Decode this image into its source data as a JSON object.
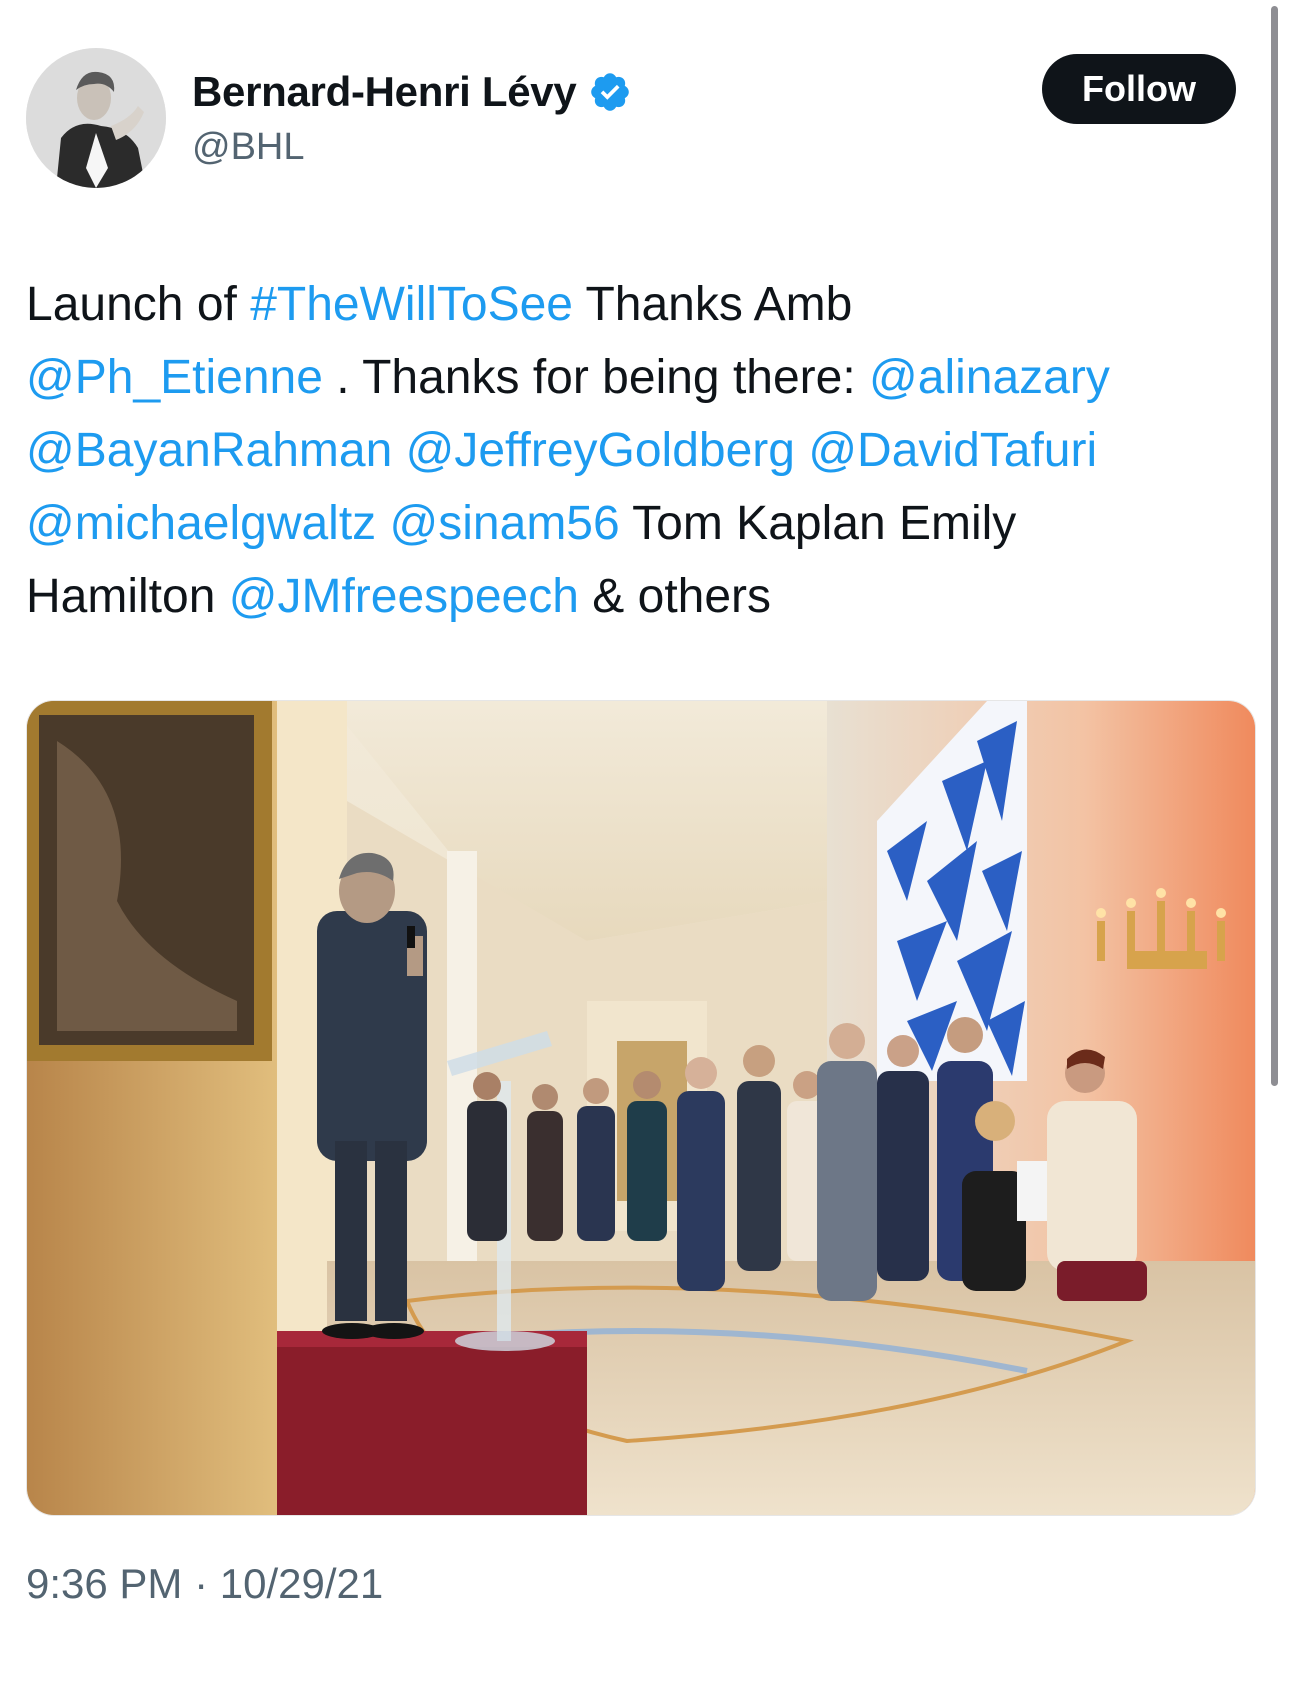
{
  "author": {
    "display_name": "Bernard-Henri Lévy",
    "handle": "@BHL",
    "verified": true,
    "avatar_icon": "profile-photo"
  },
  "follow_label": "Follow",
  "tweet": {
    "segments_line1": [
      {
        "text": "Launch of ",
        "link": false
      },
      {
        "text": "#TheWillToSee",
        "link": true
      },
      {
        "text": " Thanks Amb",
        "link": false
      }
    ],
    "segments_line2": [
      {
        "text": "@Ph_Etienne",
        "link": true
      },
      {
        "text": " . Thanks for being there: ",
        "link": false
      },
      {
        "text": "@alinazary",
        "link": true
      }
    ],
    "segments_line3": [
      {
        "text": "@BayanRahman",
        "link": true
      },
      {
        "text": " ",
        "link": false
      },
      {
        "text": "@JeffreyGoldberg",
        "link": true
      },
      {
        "text": " ",
        "link": false
      },
      {
        "text": "@DavidTafuri",
        "link": true
      }
    ],
    "segments_line4": [
      {
        "text": "@michaelgwaltz",
        "link": true
      },
      {
        "text": " ",
        "link": false
      },
      {
        "text": "@sinam56",
        "link": true
      },
      {
        "text": " Tom Kaplan Emily",
        "link": false
      }
    ],
    "segments_line5": [
      {
        "text": "Hamilton ",
        "link": false
      },
      {
        "text": "@JMfreespeech",
        "link": true
      },
      {
        "text": " & others",
        "link": false
      }
    ]
  },
  "timestamp": "9:36 PM · 10/29/21",
  "colors": {
    "link": "#1d9bf0",
    "text": "#0f1419",
    "secondary": "#536471",
    "verified": "#1d9bf0"
  }
}
